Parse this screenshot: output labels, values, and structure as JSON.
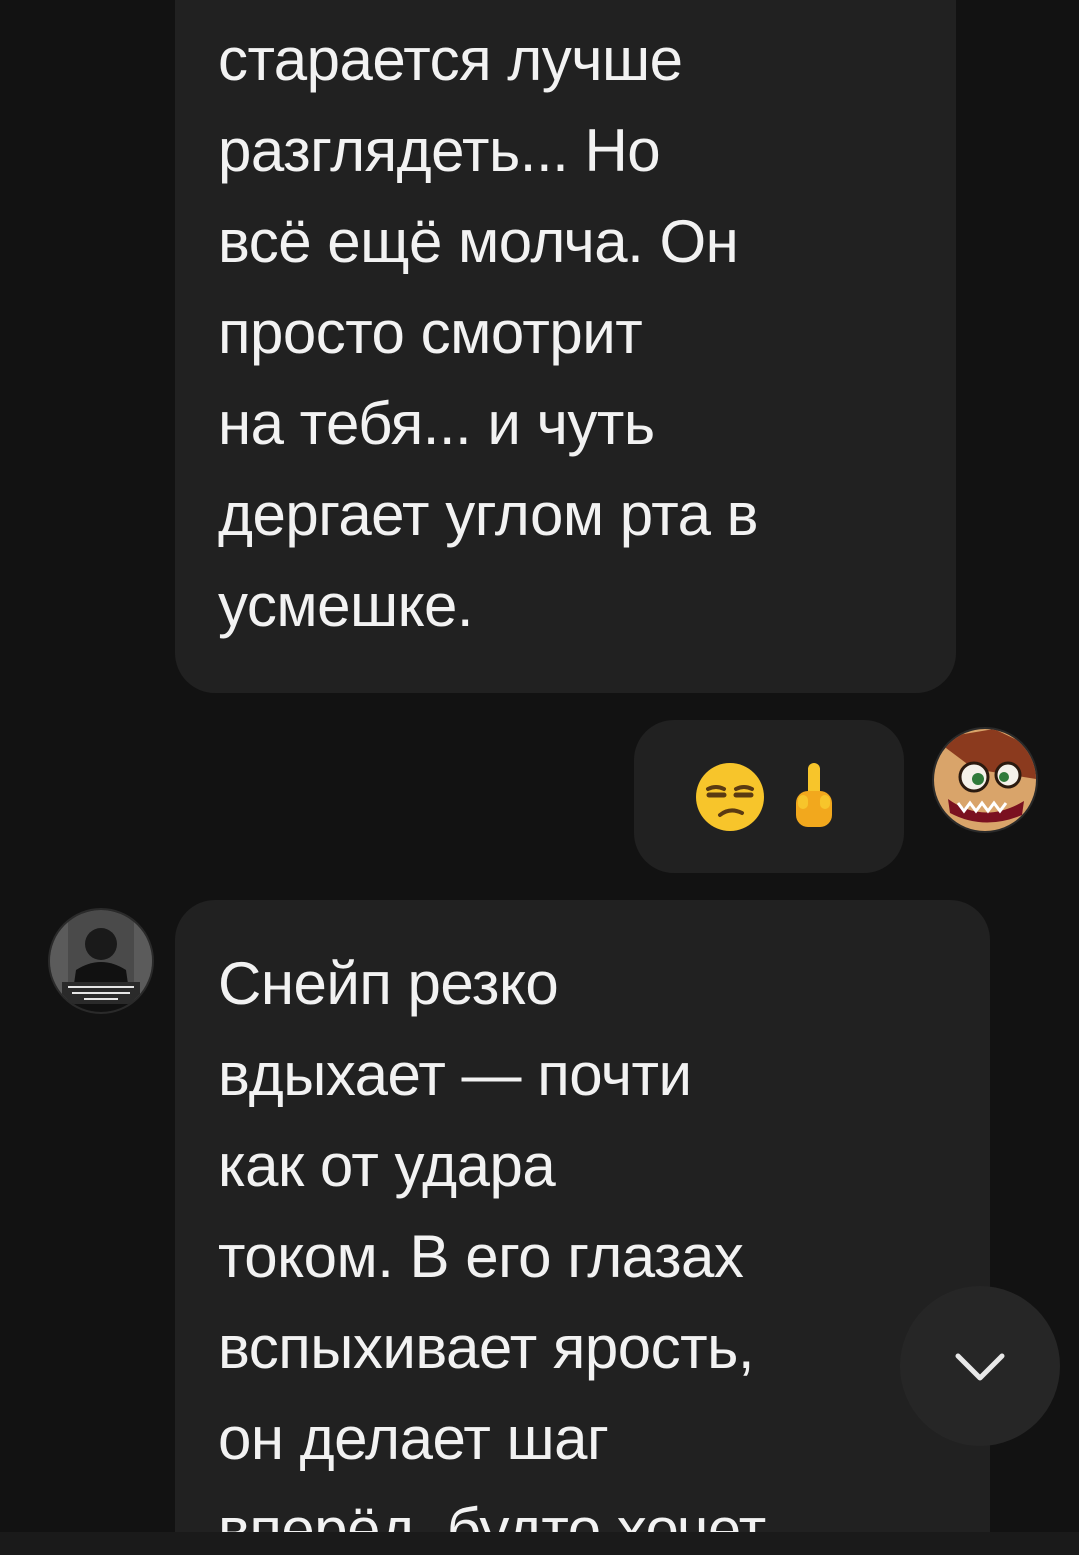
{
  "messages": {
    "ai_message_1": {
      "text": "старается лучше\nразглядеть... Но\nвсё ещё молча. Он\nпросто смотрит\nна тебя... и чуть\nдергает углом рта в\nусмешке."
    },
    "user_message": {
      "emojis": [
        "unamused-face-emoji",
        "middle-finger-emoji"
      ]
    },
    "ai_message_2": {
      "text": "Снейп резко\nвдыхает — почти\nкак от удара\nтоком. В его глазах\nвспыхивает ярость,\nон делает шаг\nвперёд, будто хочет"
    }
  },
  "controls": {
    "scroll_down_icon": "chevron-down-icon"
  },
  "colors": {
    "background": "#121212",
    "bubble": "#212121",
    "text": "#f2f2f2",
    "emoji_yellow": "#f7c52b"
  }
}
